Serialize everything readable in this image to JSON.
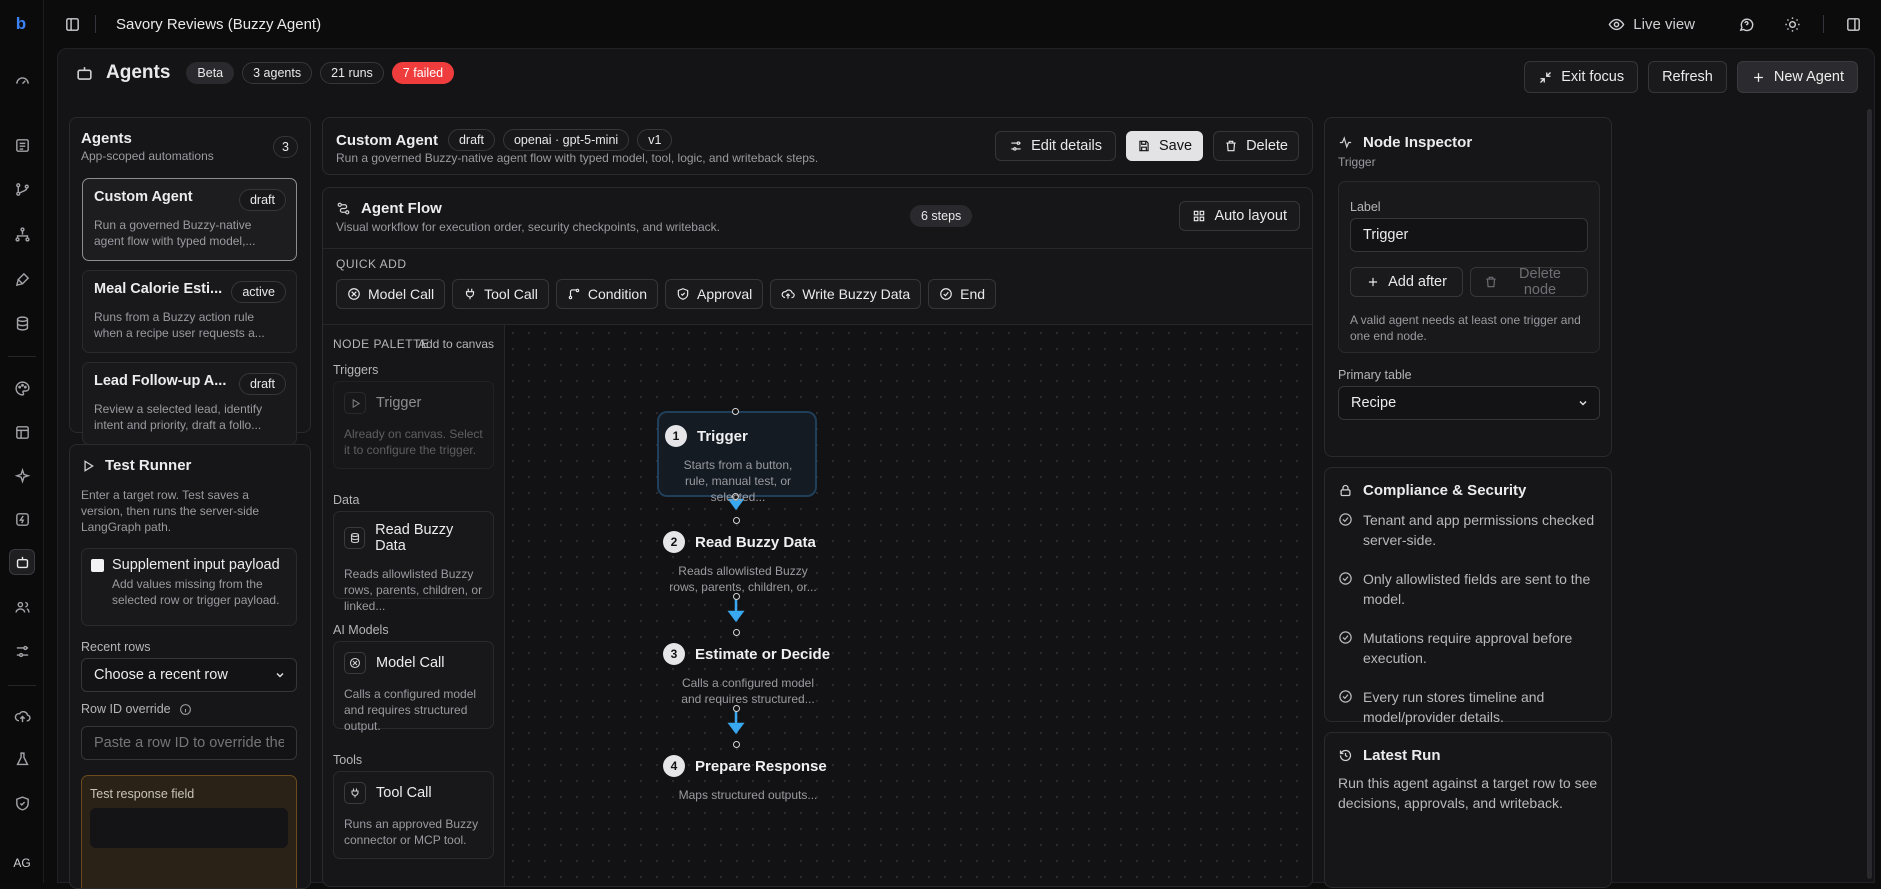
{
  "app": {
    "logo_letter": "b",
    "window_title": "Savory Reviews (Buzzy Agent)",
    "live_view_label": "Live view",
    "avatar_initials": "AG"
  },
  "header": {
    "title": "Agents",
    "beta_badge": "Beta",
    "agents_count": "3 agents",
    "runs_count": "21 runs",
    "failed_count": "7 failed",
    "exit_focus": "Exit focus",
    "refresh": "Refresh",
    "new_agent": "New Agent"
  },
  "agents_panel": {
    "title": "Agents",
    "subtitle": "App-scoped automations",
    "count": "3",
    "items": [
      {
        "name": "Custom Agent",
        "status": "draft",
        "desc": "Run a governed Buzzy-native agent flow with typed model,..."
      },
      {
        "name": "Meal Calorie Esti...",
        "status": "active",
        "desc": "Runs from a Buzzy action rule when a recipe user requests a..."
      },
      {
        "name": "Lead Follow-up A...",
        "status": "draft",
        "desc": "Review a selected lead, identify intent and priority, draft a follo..."
      }
    ]
  },
  "test_runner": {
    "title": "Test Runner",
    "description": "Enter a target row. Test saves a version, then runs the server-side LangGraph path.",
    "supplement_label": "Supplement input payload",
    "supplement_desc": "Add values missing from the selected row or trigger payload.",
    "recent_rows_label": "Recent rows",
    "recent_rows_value": "Choose a recent row",
    "row_id_label": "Row ID override",
    "row_id_placeholder": "Paste a row ID to override the",
    "test_response_label": "Test response field"
  },
  "agent_header": {
    "name": "Custom Agent",
    "status": "draft",
    "model": "openai · gpt-5-mini",
    "version": "v1",
    "description": "Run a governed Buzzy-native agent flow with typed model, tool, logic, and writeback steps.",
    "edit_details": "Edit details",
    "save": "Save",
    "delete": "Delete"
  },
  "flow": {
    "title": "Agent Flow",
    "subtitle": "Visual workflow for execution order, security checkpoints, and writeback.",
    "steps_badge": "6 steps",
    "auto_layout": "Auto layout",
    "quick_add_label": "QUICK ADD",
    "quick_add": [
      {
        "label": "Model Call",
        "icon": "model-icon"
      },
      {
        "label": "Tool Call",
        "icon": "plug-icon"
      },
      {
        "label": "Condition",
        "icon": "branch-icon"
      },
      {
        "label": "Approval",
        "icon": "shield-check-icon"
      },
      {
        "label": "Write Buzzy Data",
        "icon": "cloud-upload-icon"
      },
      {
        "label": "End",
        "icon": "check-circle-icon"
      }
    ]
  },
  "palette": {
    "title": "NODE PALETTE",
    "add_to_canvas": "Add to canvas",
    "sections": [
      "Triggers",
      "Data",
      "AI Models",
      "Tools"
    ],
    "cards": [
      {
        "title": "Trigger",
        "desc": "Already on canvas. Select it to configure the trigger."
      },
      {
        "title": "Read Buzzy Data",
        "desc": "Reads allowlisted Buzzy rows, parents, children, or linked..."
      },
      {
        "title": "Model Call",
        "desc": "Calls a configured model and requires structured output."
      },
      {
        "title": "Tool Call",
        "desc": "Runs an approved Buzzy connector or MCP tool."
      }
    ]
  },
  "canvas_nodes": [
    {
      "num": "1",
      "title": "Trigger",
      "desc": "Starts from a button, rule, manual test, or selected..."
    },
    {
      "num": "2",
      "title": "Read Buzzy Data",
      "desc": "Reads allowlisted Buzzy rows, parents, children, or..."
    },
    {
      "num": "3",
      "title": "Estimate or Decide",
      "desc": "Calls a configured model and requires structured..."
    },
    {
      "num": "4",
      "title": "Prepare Response",
      "desc": "Maps structured outputs..."
    }
  ],
  "inspector": {
    "title": "Node Inspector",
    "subtitle": "Trigger",
    "label_caption": "Label",
    "label_value": "Trigger",
    "add_after": "Add after",
    "delete_node": "Delete node",
    "hint": "A valid agent needs at least one trigger and one end node.",
    "primary_table_label": "Primary table",
    "primary_table_value": "Recipe"
  },
  "compliance": {
    "title": "Compliance & Security",
    "items": [
      "Tenant and app permissions checked server-side.",
      "Only allowlisted fields are sent to the model.",
      "Mutations require approval before execution.",
      "Every run stores timeline and model/provider details."
    ]
  },
  "latest_run": {
    "title": "Latest Run",
    "desc": "Run this agent against a target row to see decisions, approvals, and writeback."
  },
  "colors": {
    "accent_blue": "#3b82f6",
    "failed_red": "#ef3d3d",
    "flow_arrow": "#38a8f0"
  }
}
